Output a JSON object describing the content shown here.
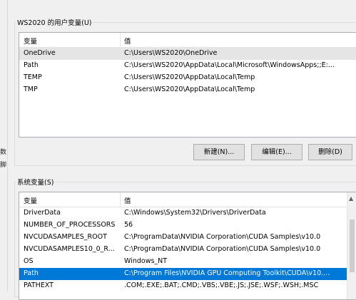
{
  "user_vars": {
    "title": "WS2020 的用户变量(U)",
    "col_var": "变量",
    "col_val": "值",
    "rows": [
      {
        "name": "OneDrive",
        "value": "C:\\Users\\WS2020\\OneDrive"
      },
      {
        "name": "Path",
        "value": "C:\\Users\\WS2020\\AppData\\Local\\Microsoft\\WindowsApps;;E:..."
      },
      {
        "name": "TEMP",
        "value": "C:\\Users\\WS2020\\AppData\\Local\\Temp"
      },
      {
        "name": "TMP",
        "value": "C:\\Users\\WS2020\\AppData\\Local\\Temp"
      }
    ],
    "btn_new": "新建(N)...",
    "btn_edit": "编辑(E)...",
    "btn_delete": "删除(D)"
  },
  "system_vars": {
    "title": "系统变量(S)",
    "col_var": "变量",
    "col_val": "值",
    "rows": [
      {
        "name": "DriverData",
        "value": "C:\\Windows\\System32\\Drivers\\DriverData"
      },
      {
        "name": "NUMBER_OF_PROCESSORS",
        "value": "56"
      },
      {
        "name": "NVCUDASAMPLES_ROOT",
        "value": "C:\\ProgramData\\NVIDIA Corporation\\CUDA Samples\\v10.0"
      },
      {
        "name": "NVCUDASAMPLES10_0_R...",
        "value": "C:\\ProgramData\\NVIDIA Corporation\\CUDA Samples\\v10.0"
      },
      {
        "name": "OS",
        "value": "Windows_NT"
      },
      {
        "name": "Path",
        "value": "C:\\Program Files\\NVIDIA GPU Computing Toolkit\\CUDA\\v10...."
      },
      {
        "name": "PATHEXT",
        "value": ".COM;.EXE;.BAT;.CMD;.VBS;.VBE;.JS;.JSE;.WSF;.WSH;.MSC"
      }
    ],
    "selected_index": 5
  },
  "left_fragments": [
    "数",
    "脚"
  ],
  "colors": {
    "selection": "#0078d7",
    "window_bg": "#f0f0f0"
  }
}
